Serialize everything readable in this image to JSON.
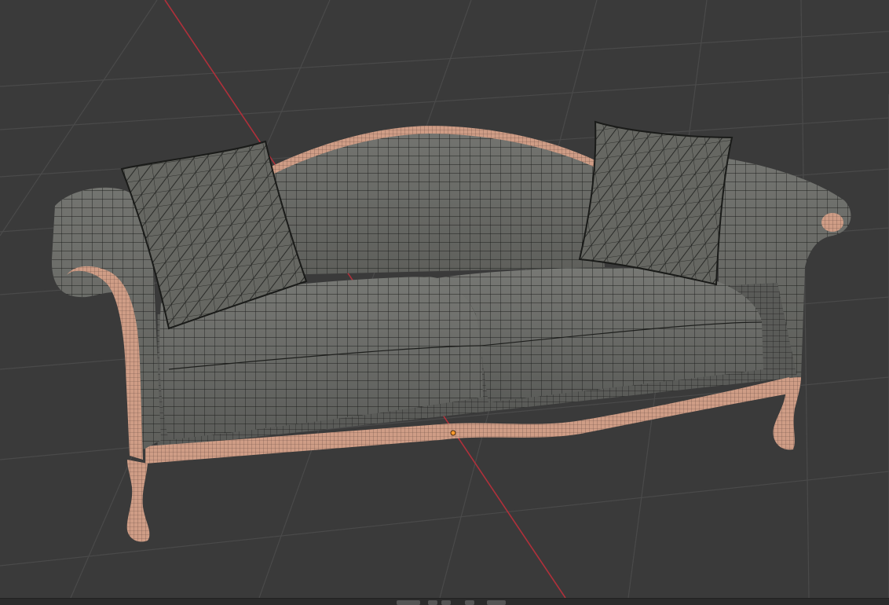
{
  "viewport": {
    "background": "#3a3a3a",
    "grid_color": "#4a4a4a",
    "x_axis_color": "#b0303a"
  },
  "object": {
    "name": "sofa-mesh",
    "display_mode": "solid-wireframe",
    "fabric_color": "#6a6b66",
    "frame_color": "#cf9d86",
    "wire_color": "#1e1f1d",
    "selection_color": "#ff9a2b"
  },
  "bottom_bar": {
    "icons": [
      "scroll-handle",
      "viewport-button-1",
      "viewport-button-2",
      "viewport-button-3",
      "viewport-button-4"
    ]
  }
}
